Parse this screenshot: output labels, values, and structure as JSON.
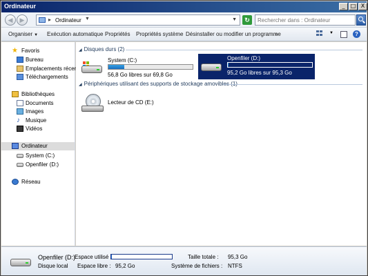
{
  "window": {
    "title": "Ordinateur",
    "controls": {
      "minimize": "_",
      "maximize": "□",
      "close": "X"
    }
  },
  "address": {
    "breadcrumb": "Ordinateur",
    "search_placeholder": "Rechercher dans : Ordinateur"
  },
  "toolbar": {
    "organize": "Organiser",
    "autoplay": "Exécution automatique",
    "properties": "Propriétés",
    "system_properties": "Propriétés système",
    "uninstall": "Désinstaller ou modifier un programme",
    "more": "»"
  },
  "nav": {
    "favorites": "Favoris",
    "desktop": "Bureau",
    "recent_places": "Emplacements récents",
    "downloads": "Téléchargements",
    "libraries": "Bibliothèques",
    "documents": "Documents",
    "images": "Images",
    "music": "Musique",
    "videos": "Vidéos",
    "computer": "Ordinateur",
    "drive_c": "System (C:)",
    "drive_d": "Openfiler (D:)",
    "network": "Réseau"
  },
  "content": {
    "hard_disks_header": "Disques durs (2)",
    "removable_header": "Périphériques utilisant des supports de stockage amovibles (1)",
    "drives": [
      {
        "name": "System (C:)",
        "free_text": "56,8 Go libres sur 69,8 Go",
        "used_fraction": 0.19
      },
      {
        "name": "Openfiler (D:)",
        "free_text": "95,2 Go libres sur 95,3 Go",
        "used_fraction": 0.01
      }
    ],
    "cd_drive": "Lecteur de CD (E:)"
  },
  "details": {
    "name": "Openfiler (D:)",
    "type": "Disque local",
    "used_label": "Espace utilisé :",
    "free_label": "Espace libre :",
    "free_value": "95,2 Go",
    "total_label": "Taille totale :",
    "total_value": "95,3 Go",
    "fs_label": "Système de fichiers :",
    "fs_value": "NTFS",
    "used_fraction": 0.01
  },
  "colors": {
    "selection": "#0a246a",
    "bar_fill": "#1a6fc0"
  }
}
